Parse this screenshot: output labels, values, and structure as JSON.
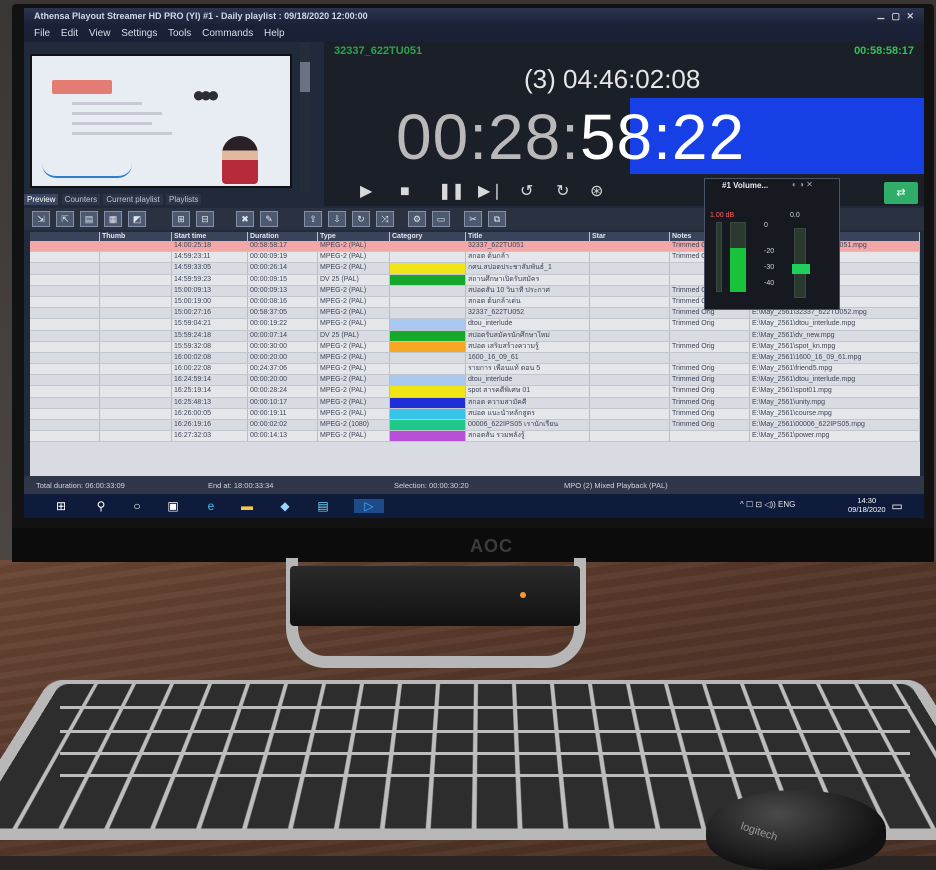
{
  "window": {
    "title": "Athensa Playout Streamer HD PRO (YI) #1 - Daily playlist : 09/18/2020 12:00:00",
    "controls": "⚊ ▢ ✕"
  },
  "menu": [
    "File",
    "Edit",
    "View",
    "Settings",
    "Tools",
    "Commands",
    "Help"
  ],
  "tabs": [
    "Preview",
    "Counters",
    "Current playlist",
    "Playlists"
  ],
  "clip": {
    "name": "32337_622TU051",
    "remaining": "00:58:58:17"
  },
  "counters": {
    "total": "(3) 04:46:02:08",
    "elapsed_prefix": "00:28:",
    "elapsed_highlight": "58:22"
  },
  "volume_popup": {
    "title": "#1 Volume...",
    "scale": [
      "0",
      "-20",
      "-30",
      "-40"
    ],
    "gain": "0.0",
    "value_label": "1.00 dB"
  },
  "table": {
    "headers": [
      "",
      "Thumb",
      "Start time",
      "Duration",
      "Type",
      "Category",
      "Title",
      "Star",
      "Notes",
      "File"
    ],
    "rows": [
      {
        "start": "14:00:25:18",
        "dur": "00:58:58:17",
        "type": "MPEG-2 (PAL)",
        "cat": "",
        "title": "32337_622TU051",
        "note": "Trimmed Orig",
        "file": "E:\\May_2561\\32337_622TU051.mpg",
        "cat_color": ""
      },
      {
        "start": "14:59:23:11",
        "dur": "00:00:09:19",
        "type": "MPEG-2 (PAL)",
        "cat": "",
        "title": "สกอต ต้นกล้า",
        "note": "Trimmed Orig",
        "file": "E:\\May_2561\\spot.mpg",
        "cat_color": ""
      },
      {
        "start": "14:59:33:05",
        "dur": "00:00:26:14",
        "type": "MPEG-2 (PAL)",
        "cat": "",
        "title": "กศน.สปอตประชาสัมพันธ์_1",
        "note": "",
        "file": "E:\\May_2561\\spot_1.mpg",
        "cat_color": "#f2e516"
      },
      {
        "start": "14:59:59:23",
        "dur": "00:00:09:15",
        "type": "DV 25 (PAL)",
        "cat": "",
        "title": "สถานศึกษาเปิดรับสมัคร",
        "note": "",
        "file": "E:\\May_2561\\dv_spot.mpg",
        "cat_color": "#16a82a"
      },
      {
        "start": "15:00:09:13",
        "dur": "00:00:09:13",
        "type": "MPEG-2 (PAL)",
        "cat": "",
        "title": "สปอตสั้น 10 วินาที ประกาศ",
        "note": "Trimmed Orig",
        "file": "E:\\May_2561\\spot10.mpg",
        "cat_color": ""
      },
      {
        "start": "15:00:19:00",
        "dur": "00:00:08:16",
        "type": "MPEG-2 (PAL)",
        "cat": "",
        "title": "สกอต ต้นกล้าเด่น",
        "note": "Trimmed Orig",
        "file": "E:\\May_2561\\spot2.mpg",
        "cat_color": ""
      },
      {
        "start": "15:00:27:16",
        "dur": "00:58:37:05",
        "type": "MPEG-2 (PAL)",
        "cat": "",
        "title": "32337_622TU052",
        "note": "Trimmed Orig",
        "file": "E:\\May_2561\\32337_622TU052.mpg",
        "cat_color": ""
      },
      {
        "start": "15:59:04:21",
        "dur": "00:00:19:22",
        "type": "MPEG-2 (PAL)",
        "cat": "",
        "title": "dtou_interlude",
        "note": "Trimmed Orig",
        "file": "E:\\May_2561\\dtou_interlude.mpg",
        "cat_color": "#a9c8f0"
      },
      {
        "start": "15:59:24:18",
        "dur": "00:00:07:14",
        "type": "DV 25 (PAL)",
        "cat": "",
        "title": "สปอตรับสมัครนักศึกษาใหม่",
        "note": "",
        "file": "E:\\May_2561\\dv_new.mpg",
        "cat_color": "#16a82a"
      },
      {
        "start": "15:59:32:08",
        "dur": "00:00:30:00",
        "type": "MPEG-2 (PAL)",
        "cat": "",
        "title": "สปอต เสริมสร้างความรู้",
        "note": "Trimmed Orig",
        "file": "E:\\May_2561\\spot_kn.mpg",
        "cat_color": "#f6a623"
      },
      {
        "start": "16:00:02:08",
        "dur": "00:00:20:00",
        "type": "MPEG-2 (PAL)",
        "cat": "",
        "title": "1600_16_09_61",
        "note": "",
        "file": "E:\\May_2561\\1600_16_09_61.mpg",
        "cat_color": ""
      },
      {
        "start": "16:00:22:08",
        "dur": "00:24:37:06",
        "type": "MPEG-2 (PAL)",
        "cat": "",
        "title": "รายการ เพื่อนแท้ ตอน 5",
        "note": "Trimmed Orig",
        "file": "E:\\May_2561\\friend5.mpg",
        "cat_color": ""
      },
      {
        "start": "16:24:59:14",
        "dur": "00:00:20:00",
        "type": "MPEG-2 (PAL)",
        "cat": "",
        "title": "dtou_interlude",
        "note": "Trimmed Orig",
        "file": "E:\\May_2561\\dtou_interlude.mpg",
        "cat_color": "#a9c8f0"
      },
      {
        "start": "16:25:19:14",
        "dur": "00:00:28:24",
        "type": "MPEG-2 (PAL)",
        "cat": "",
        "title": "spot สารคดีพิเศษ 01",
        "note": "Trimmed Orig",
        "file": "E:\\May_2561\\spot01.mpg",
        "cat_color": "#f2e516"
      },
      {
        "start": "16:25:48:13",
        "dur": "00:00:10:17",
        "type": "MPEG-2 (PAL)",
        "cat": "",
        "title": "สกอต ความสามัคคี",
        "note": "Trimmed Orig",
        "file": "E:\\May_2561\\unity.mpg",
        "cat_color": "#1f2fd8"
      },
      {
        "start": "16:26:00:05",
        "dur": "00:00:19:11",
        "type": "MPEG-2 (PAL)",
        "cat": "",
        "title": "สปอต แนะนำหลักสูตร",
        "note": "Trimmed Orig",
        "file": "E:\\May_2561\\course.mpg",
        "cat_color": "#38c3e8"
      },
      {
        "start": "16:26:19:16",
        "dur": "00:00:02:02",
        "type": "MPEG-2 (1080)",
        "cat": "",
        "title": "00006_622IPS05 เรานักเรียน",
        "note": "Trimmed Orig",
        "file": "E:\\May_2561\\00006_622IPS05.mpg",
        "cat_color": "#1ec98a"
      },
      {
        "start": "16:27:32:03",
        "dur": "00:00:14:13",
        "type": "MPEG-2 (PAL)",
        "cat": "",
        "title": "สกอตสั้น รวมพลังรู้",
        "note": "",
        "file": "E:\\May_2561\\power.mpg",
        "cat_color": "#b64fd6"
      }
    ]
  },
  "status": {
    "total_duration": "Total duration: 06:00:33:09",
    "end_at": "End at: 18:00:33:34",
    "selection": "Selection: 00:00:30:20",
    "device": "MPO (2) Mixed Playback (PAL)"
  },
  "taskbar": {
    "tray": "^ ☐ ⊡ ◁)) ENG",
    "time": "14:30",
    "date": "09/18/2020"
  },
  "monitor_brand": "AOC",
  "mouse_brand": "logitech"
}
